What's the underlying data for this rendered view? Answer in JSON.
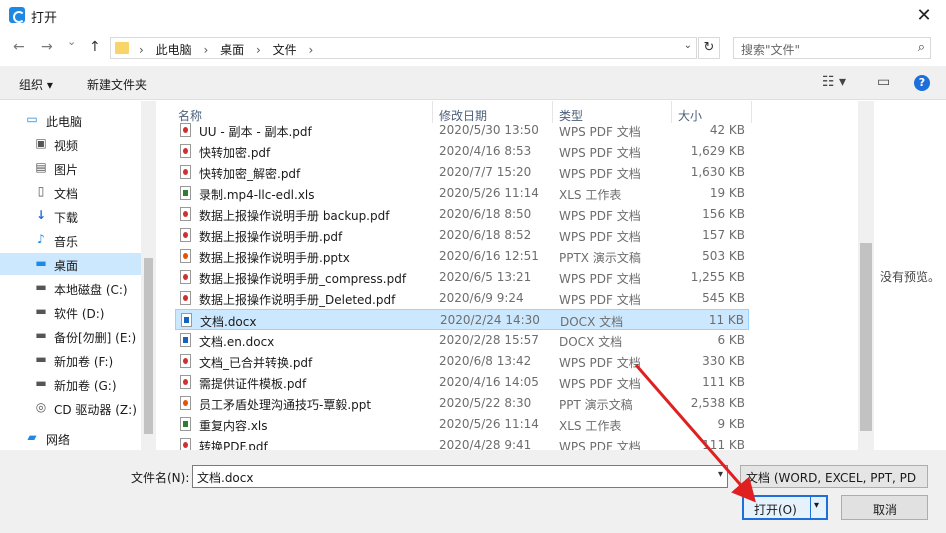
{
  "window": {
    "title": "打开",
    "close": "✕"
  },
  "nav": {
    "back": "←",
    "forward": "→",
    "dropdown": "⌄",
    "up": "↑",
    "breadcrumb": [
      "此电脑",
      "桌面",
      "文件"
    ],
    "separator": "›",
    "refresh": "↻",
    "search_placeholder": "搜索\"文件\""
  },
  "toolbar": {
    "organize": "组织 ▾",
    "new_folder": "新建文件夹",
    "view": "☷ ▾",
    "pane": "▭",
    "help": "?"
  },
  "sidebar": {
    "items": [
      {
        "label": "此电脑",
        "icon": "computer-icon"
      },
      {
        "label": "视频",
        "icon": "video-icon"
      },
      {
        "label": "图片",
        "icon": "picture-icon"
      },
      {
        "label": "文档",
        "icon": "document-icon"
      },
      {
        "label": "下载",
        "icon": "download-icon"
      },
      {
        "label": "音乐",
        "icon": "music-icon"
      },
      {
        "label": "桌面",
        "icon": "desktop-icon"
      },
      {
        "label": "本地磁盘 (C:)",
        "icon": "drive-icon"
      },
      {
        "label": "软件 (D:)",
        "icon": "drive-icon"
      },
      {
        "label": "备份[勿删] (E:)",
        "icon": "drive-icon"
      },
      {
        "label": "新加卷 (F:)",
        "icon": "drive-icon"
      },
      {
        "label": "新加卷 (G:)",
        "icon": "drive-icon"
      },
      {
        "label": "CD 驱动器 (Z:)",
        "icon": "cd-drive-icon"
      },
      {
        "label": "网络",
        "icon": "network-icon"
      }
    ]
  },
  "columns": {
    "name": "名称",
    "date": "修改日期",
    "type": "类型",
    "size": "大小"
  },
  "files": [
    {
      "name": "UU - 副本 - 副本.pdf",
      "date": "2020/5/30 13:50",
      "type": "WPS PDF 文档",
      "size": "42 KB",
      "kind": "pdf"
    },
    {
      "name": "快转加密.pdf",
      "date": "2020/4/16 8:53",
      "type": "WPS PDF 文档",
      "size": "1,629 KB",
      "kind": "pdf"
    },
    {
      "name": "快转加密_解密.pdf",
      "date": "2020/7/7 15:20",
      "type": "WPS PDF 文档",
      "size": "1,630 KB",
      "kind": "pdf"
    },
    {
      "name": "录制.mp4-llc-edl.xls",
      "date": "2020/5/26 11:14",
      "type": "XLS 工作表",
      "size": "19 KB",
      "kind": "xls"
    },
    {
      "name": "数据上报操作说明手册 backup.pdf",
      "date": "2020/6/18 8:50",
      "type": "WPS PDF 文档",
      "size": "156 KB",
      "kind": "pdf"
    },
    {
      "name": "数据上报操作说明手册.pdf",
      "date": "2020/6/18 8:52",
      "type": "WPS PDF 文档",
      "size": "157 KB",
      "kind": "pdf"
    },
    {
      "name": "数据上报操作说明手册.pptx",
      "date": "2020/6/16 12:51",
      "type": "PPTX 演示文稿",
      "size": "503 KB",
      "kind": "ppt"
    },
    {
      "name": "数据上报操作说明手册_compress.pdf",
      "date": "2020/6/5 13:21",
      "type": "WPS PDF 文档",
      "size": "1,255 KB",
      "kind": "pdf"
    },
    {
      "name": "数据上报操作说明手册_Deleted.pdf",
      "date": "2020/6/9 9:24",
      "type": "WPS PDF 文档",
      "size": "545 KB",
      "kind": "pdf"
    },
    {
      "name": "文档.docx",
      "date": "2020/2/24 14:30",
      "type": "DOCX 文档",
      "size": "11 KB",
      "kind": "doc",
      "selected": true
    },
    {
      "name": "文档.en.docx",
      "date": "2020/2/28 15:57",
      "type": "DOCX 文档",
      "size": "6 KB",
      "kind": "doc"
    },
    {
      "name": "文档_已合并转换.pdf",
      "date": "2020/6/8 13:42",
      "type": "WPS PDF 文档",
      "size": "330 KB",
      "kind": "pdf"
    },
    {
      "name": "需提供证件模板.pdf",
      "date": "2020/4/16 14:05",
      "type": "WPS PDF 文档",
      "size": "111 KB",
      "kind": "pdf"
    },
    {
      "name": "员工矛盾处理沟通技巧-覃毅.ppt",
      "date": "2020/5/22 8:30",
      "type": "PPT 演示文稿",
      "size": "2,538 KB",
      "kind": "ppt"
    },
    {
      "name": "重复内容.xls",
      "date": "2020/5/26 11:14",
      "type": "XLS 工作表",
      "size": "9 KB",
      "kind": "xls"
    },
    {
      "name": "转换PDF.pdf",
      "date": "2020/4/28 9:41",
      "type": "WPS PDF 文档",
      "size": "111 KB",
      "kind": "pdf"
    }
  ],
  "preview": {
    "empty_text": "没有预览。"
  },
  "bottom": {
    "filename_label": "文件名(N):",
    "filename_value": "文档.docx",
    "filetype_value": "文档 (WORD, EXCEL, PPT, PD",
    "open_label": "打开(O)",
    "cancel_label": "取消",
    "dropdown_glyph": "▾"
  }
}
